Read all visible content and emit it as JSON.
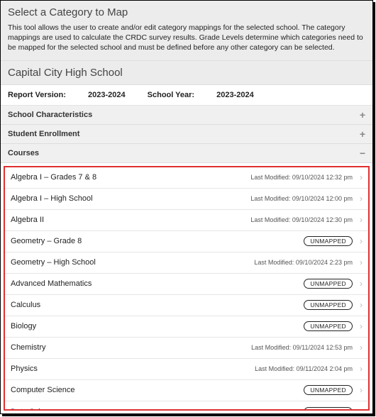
{
  "header": {
    "title": "Select a Category to Map",
    "intro": "This tool allows the user to create and/or edit category mappings for the selected school. The category mappings are used to calculate the CRDC survey results. Grade Levels determine which categories need to be mapped for the selected school and must be defined before any other category can be selected."
  },
  "school": {
    "name": "Capital City High School",
    "report_version_label": "Report Version:",
    "report_version_value": "2023-2024",
    "school_year_label": "School Year:",
    "school_year_value": "2023-2024"
  },
  "sections": [
    {
      "label": "School Characteristics",
      "expanded": false
    },
    {
      "label": "Student Enrollment",
      "expanded": false
    },
    {
      "label": "Courses",
      "expanded": true
    }
  ],
  "status_prefix": "Last Modified: ",
  "unmapped_label": "UNMAPPED",
  "courses": [
    {
      "name": "Algebra I – Grades 7 & 8",
      "modified": "09/10/2024 12:32 pm"
    },
    {
      "name": "Algebra I – High School",
      "modified": "09/10/2024 12:00 pm"
    },
    {
      "name": "Algebra II",
      "modified": "09/10/2024 12:30 pm"
    },
    {
      "name": "Geometry – Grade 8",
      "unmapped": true
    },
    {
      "name": "Geometry – High School",
      "modified": "09/10/2024 2:23 pm"
    },
    {
      "name": "Advanced Mathematics",
      "unmapped": true
    },
    {
      "name": "Calculus",
      "unmapped": true
    },
    {
      "name": "Biology",
      "unmapped": true
    },
    {
      "name": "Chemistry",
      "modified": "09/11/2024 12:53 pm"
    },
    {
      "name": "Physics",
      "modified": "09/11/2024 2:04 pm"
    },
    {
      "name": "Computer Science",
      "unmapped": true
    },
    {
      "name": "Data Science",
      "unmapped": true
    }
  ]
}
